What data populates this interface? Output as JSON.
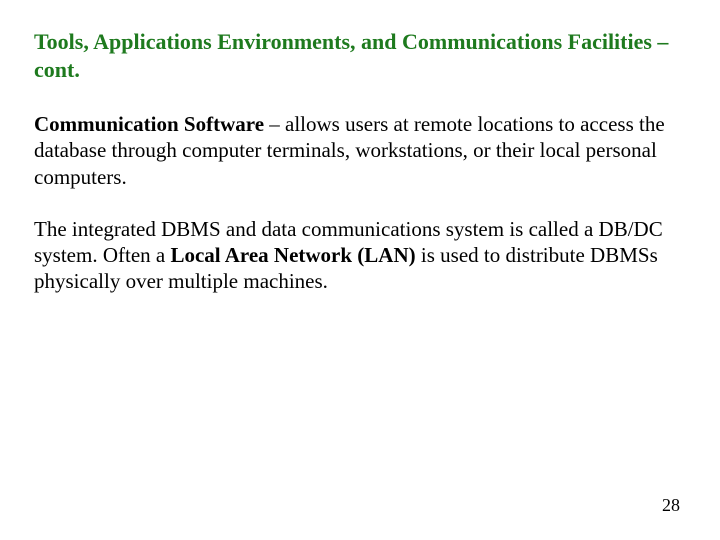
{
  "title": "Tools, Applications Environments, and Communications Facilities – cont.",
  "p1": {
    "bold": "Communication Software",
    "rest": " – allows users at remote locations to access the database through computer terminals, workstations, or their local personal computers."
  },
  "p2": {
    "a": "The integrated DBMS and data communications system is called a DB/DC system.  Often a ",
    "bold": "Local Area Network (LAN)",
    "b": " is used to distribute DBMSs physically over multiple machines."
  },
  "page_number": "28"
}
